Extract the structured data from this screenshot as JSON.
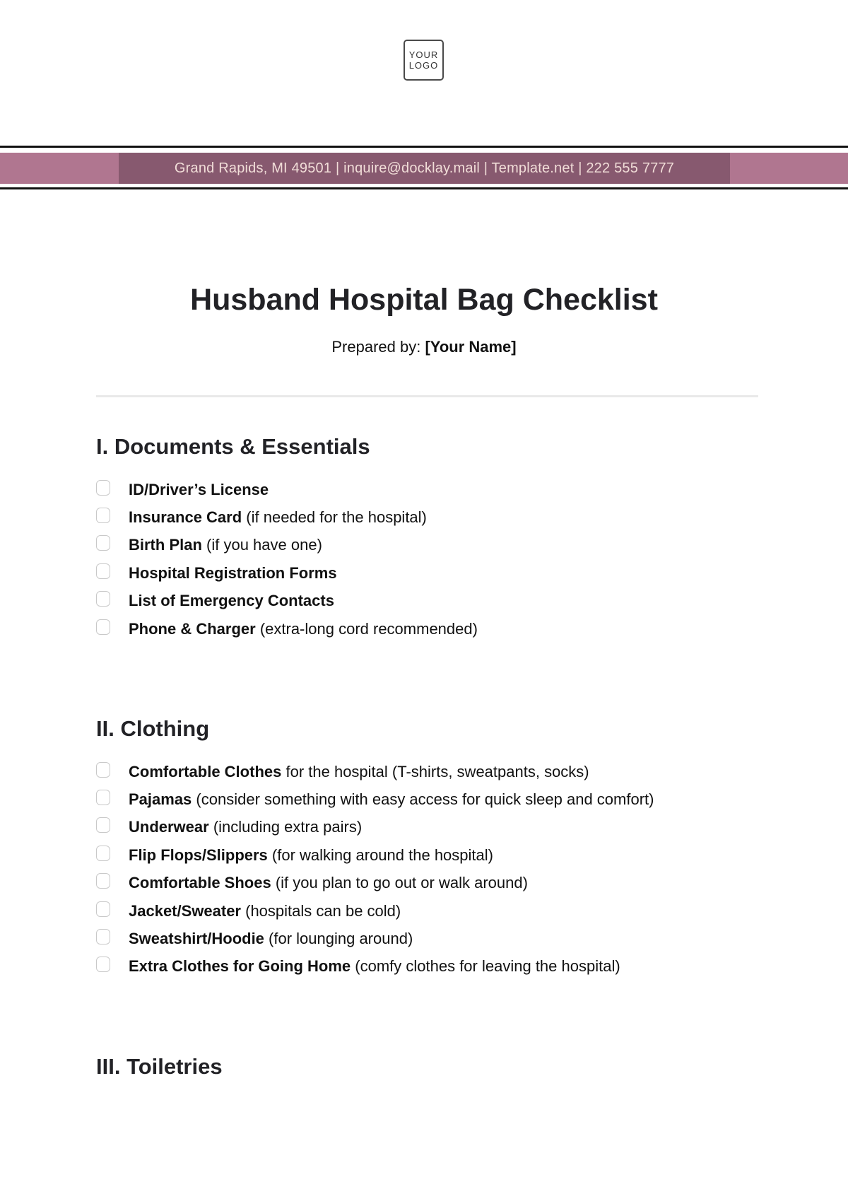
{
  "logo": {
    "line1": "YOUR",
    "line2": "LOGO"
  },
  "header_band": {
    "contact_text": "Grand Rapids, MI 49501 | inquire@docklay.mail | Template.net | 222 555 7777",
    "colors": {
      "outer": "#b07690",
      "inner": "#87596f",
      "text": "#f1ddd8"
    }
  },
  "document": {
    "title": "Husband Hospital Bag Checklist",
    "prepared_label": "Prepared by:",
    "prepared_name": "[Your Name]"
  },
  "sections": [
    {
      "title": "I. Documents & Essentials",
      "items": [
        {
          "bold": "ID/Driver’s License",
          "rest": "",
          "checked": false
        },
        {
          "bold": "Insurance Card",
          "rest": " (if needed for the hospital)",
          "checked": false
        },
        {
          "bold": "Birth Plan",
          "rest": " (if you have one)",
          "checked": false
        },
        {
          "bold": "Hospital Registration Forms",
          "rest": "",
          "checked": false
        },
        {
          "bold": "List of Emergency Contacts",
          "rest": "",
          "checked": false
        },
        {
          "bold": "Phone & Charger",
          "rest": " (extra-long cord recommended)",
          "checked": false
        }
      ]
    },
    {
      "title": "II. Clothing",
      "items": [
        {
          "bold": "Comfortable Clothes",
          "rest": " for the hospital (T-shirts, sweatpants, socks)",
          "checked": false
        },
        {
          "bold": "Pajamas",
          "rest": " (consider something with easy access for quick sleep and comfort)",
          "checked": false
        },
        {
          "bold": "Underwear",
          "rest": " (including extra pairs)",
          "checked": false
        },
        {
          "bold": "Flip Flops/Slippers",
          "rest": " (for walking around the hospital)",
          "checked": false
        },
        {
          "bold": "Comfortable Shoes",
          "rest": " (if you plan to go out or walk around)",
          "checked": false
        },
        {
          "bold": "Jacket/Sweater",
          "rest": " (hospitals can be cold)",
          "checked": false
        },
        {
          "bold": "Sweatshirt/Hoodie",
          "rest": " (for lounging around)",
          "checked": false
        },
        {
          "bold": "Extra Clothes for Going Home",
          "rest": " (comfy clothes for leaving the hospital)",
          "checked": false
        }
      ]
    },
    {
      "title": "III. Toiletries",
      "items": []
    }
  ]
}
